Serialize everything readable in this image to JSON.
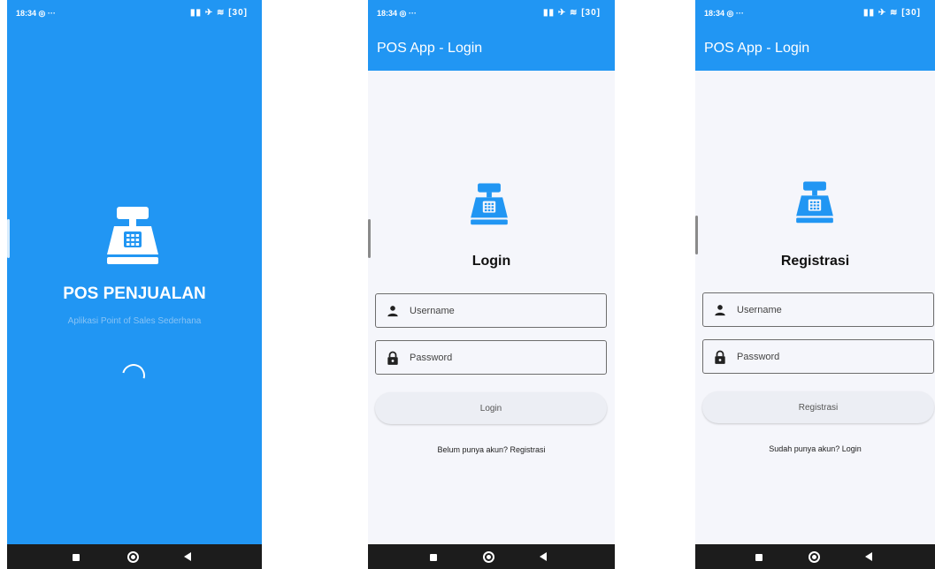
{
  "colors": {
    "primary": "#2196f3",
    "background": "#f5f6fb",
    "nav_bar": "#1c1c1c"
  },
  "status_bar": {
    "time": "18:34",
    "left_indicators": "◎ ···",
    "right_icons": [
      "signal-icon",
      "nfc-icon",
      "airplane-icon",
      "wifi-icon",
      "battery-icon"
    ],
    "battery": "30"
  },
  "nav_bar": {
    "icons": [
      "recents-square-icon",
      "home-circle-icon",
      "back-triangle-icon"
    ]
  },
  "splash": {
    "icon": "cash-register-icon",
    "title": "POS PENJUALAN",
    "subtitle": "Aplikasi Point of Sales Sederhana",
    "loading_icon": "loading-spinner-icon"
  },
  "login": {
    "app_title": "POS App - Login",
    "icon": "cash-register-icon",
    "heading": "Login",
    "username_placeholder": "Username",
    "password_placeholder": "Password",
    "button_label": "Login",
    "link_text": "Belum punya akun? Registrasi"
  },
  "register": {
    "app_title": "POS App - Login",
    "icon": "cash-register-icon",
    "heading": "Registrasi",
    "username_placeholder": "Username",
    "password_placeholder": "Password",
    "button_label": "Registrasi",
    "link_text": "Sudah punya akun? Login"
  }
}
